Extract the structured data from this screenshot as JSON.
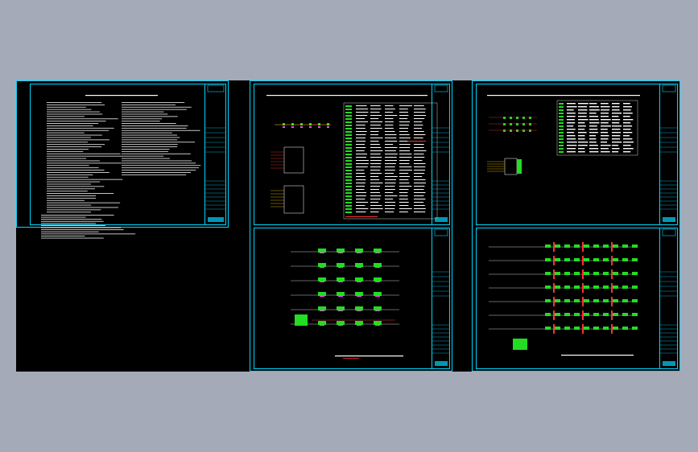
{
  "viewer": {
    "background": "#a4aab8",
    "canvas_color": "#000000",
    "frame_color": "#00d7ff"
  },
  "sheets": [
    {
      "id": "sheet-1",
      "content": "notes"
    },
    {
      "id": "sheet-2",
      "content": "system-diagram-with-table"
    },
    {
      "id": "sheet-3",
      "content": "system-diagram-with-table"
    },
    {
      "id": "sheet-4",
      "content": "riser-diagram"
    },
    {
      "id": "sheet-5",
      "content": "riser-diagram"
    }
  ],
  "colors": {
    "text": "#ffffff",
    "device": "#22dd22",
    "accent_red": "#ff3030",
    "accent_magenta": "#ff40ff",
    "accent_yellow": "#ffd400",
    "title_block": "#00d7ff"
  }
}
